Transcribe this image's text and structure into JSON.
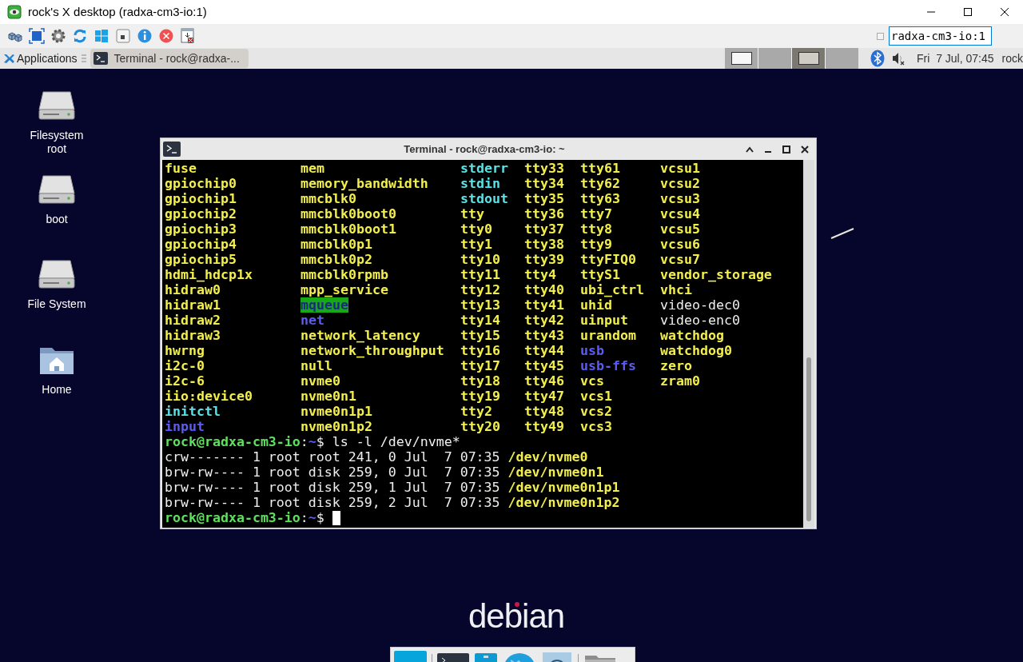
{
  "viewer_window": {
    "title": "rock's X desktop (radxa-cm3-io:1)",
    "address": "radxa-cm3-io:1"
  },
  "panel": {
    "menu": "Applications",
    "tasks": [
      {
        "label": "Terminal - rock@radxa-...",
        "selected": true
      }
    ],
    "workspaces": [
      {
        "selected": false,
        "has_window": true
      },
      {
        "selected": false,
        "has_window": false
      },
      {
        "selected": true,
        "has_window": true
      },
      {
        "selected": false,
        "has_window": false
      }
    ],
    "clock": "Fri  7 Jul, 07:45",
    "user": "rock"
  },
  "desktop_icons": [
    {
      "label": "Filesystem root",
      "kind": "drive"
    },
    {
      "label": "boot",
      "kind": "drive"
    },
    {
      "label": "File System",
      "kind": "drive"
    },
    {
      "label": "Home",
      "kind": "home"
    }
  ],
  "terminal": {
    "title": "Terminal - rock@radxa-cm3-io: ~",
    "listing": [
      [
        {
          "name": "fuse",
          "kind": "device"
        },
        {
          "name": "mem",
          "kind": "device"
        },
        {
          "name": "stderr",
          "kind": "link"
        },
        {
          "name": "tty33",
          "kind": "device"
        },
        {
          "name": "tty61",
          "kind": "device"
        },
        {
          "name": "vcsu1",
          "kind": "device"
        }
      ],
      [
        {
          "name": "gpiochip0",
          "kind": "device"
        },
        {
          "name": "memory_bandwidth",
          "kind": "device"
        },
        {
          "name": "stdin",
          "kind": "link"
        },
        {
          "name": "tty34",
          "kind": "device"
        },
        {
          "name": "tty62",
          "kind": "device"
        },
        {
          "name": "vcsu2",
          "kind": "device"
        }
      ],
      [
        {
          "name": "gpiochip1",
          "kind": "device"
        },
        {
          "name": "mmcblk0",
          "kind": "device"
        },
        {
          "name": "stdout",
          "kind": "link"
        },
        {
          "name": "tty35",
          "kind": "device"
        },
        {
          "name": "tty63",
          "kind": "device"
        },
        {
          "name": "vcsu3",
          "kind": "device"
        }
      ],
      [
        {
          "name": "gpiochip2",
          "kind": "device"
        },
        {
          "name": "mmcblk0boot0",
          "kind": "device"
        },
        {
          "name": "tty",
          "kind": "device"
        },
        {
          "name": "tty36",
          "kind": "device"
        },
        {
          "name": "tty7",
          "kind": "device"
        },
        {
          "name": "vcsu4",
          "kind": "device"
        }
      ],
      [
        {
          "name": "gpiochip3",
          "kind": "device"
        },
        {
          "name": "mmcblk0boot1",
          "kind": "device"
        },
        {
          "name": "tty0",
          "kind": "device"
        },
        {
          "name": "tty37",
          "kind": "device"
        },
        {
          "name": "tty8",
          "kind": "device"
        },
        {
          "name": "vcsu5",
          "kind": "device"
        }
      ],
      [
        {
          "name": "gpiochip4",
          "kind": "device"
        },
        {
          "name": "mmcblk0p1",
          "kind": "device"
        },
        {
          "name": "tty1",
          "kind": "device"
        },
        {
          "name": "tty38",
          "kind": "device"
        },
        {
          "name": "tty9",
          "kind": "device"
        },
        {
          "name": "vcsu6",
          "kind": "device"
        }
      ],
      [
        {
          "name": "gpiochip5",
          "kind": "device"
        },
        {
          "name": "mmcblk0p2",
          "kind": "device"
        },
        {
          "name": "tty10",
          "kind": "device"
        },
        {
          "name": "tty39",
          "kind": "device"
        },
        {
          "name": "ttyFIQ0",
          "kind": "device"
        },
        {
          "name": "vcsu7",
          "kind": "device"
        }
      ],
      [
        {
          "name": "hdmi_hdcp1x",
          "kind": "device"
        },
        {
          "name": "mmcblk0rpmb",
          "kind": "device"
        },
        {
          "name": "tty11",
          "kind": "device"
        },
        {
          "name": "tty4",
          "kind": "device"
        },
        {
          "name": "ttyS1",
          "kind": "device"
        },
        {
          "name": "vendor_storage",
          "kind": "device"
        }
      ],
      [
        {
          "name": "hidraw0",
          "kind": "device"
        },
        {
          "name": "mpp_service",
          "kind": "device"
        },
        {
          "name": "tty12",
          "kind": "device"
        },
        {
          "name": "tty40",
          "kind": "device"
        },
        {
          "name": "ubi_ctrl",
          "kind": "device"
        },
        {
          "name": "vhci",
          "kind": "device"
        }
      ],
      [
        {
          "name": "hidraw1",
          "kind": "device"
        },
        {
          "name": "mqueue",
          "kind": "sticky_dir"
        },
        {
          "name": "tty13",
          "kind": "device"
        },
        {
          "name": "tty41",
          "kind": "device"
        },
        {
          "name": "uhid",
          "kind": "device"
        },
        {
          "name": "video-dec0",
          "kind": "plain"
        }
      ],
      [
        {
          "name": "hidraw2",
          "kind": "device"
        },
        {
          "name": "net",
          "kind": "dir"
        },
        {
          "name": "tty14",
          "kind": "device"
        },
        {
          "name": "tty42",
          "kind": "device"
        },
        {
          "name": "uinput",
          "kind": "device"
        },
        {
          "name": "video-enc0",
          "kind": "plain"
        }
      ],
      [
        {
          "name": "hidraw3",
          "kind": "device"
        },
        {
          "name": "network_latency",
          "kind": "device"
        },
        {
          "name": "tty15",
          "kind": "device"
        },
        {
          "name": "tty43",
          "kind": "device"
        },
        {
          "name": "urandom",
          "kind": "device"
        },
        {
          "name": "watchdog",
          "kind": "device"
        }
      ],
      [
        {
          "name": "hwrng",
          "kind": "device"
        },
        {
          "name": "network_throughput",
          "kind": "device"
        },
        {
          "name": "tty16",
          "kind": "device"
        },
        {
          "name": "tty44",
          "kind": "device"
        },
        {
          "name": "usb",
          "kind": "dir"
        },
        {
          "name": "watchdog0",
          "kind": "device"
        }
      ],
      [
        {
          "name": "i2c-0",
          "kind": "device"
        },
        {
          "name": "null",
          "kind": "device"
        },
        {
          "name": "tty17",
          "kind": "device"
        },
        {
          "name": "tty45",
          "kind": "device"
        },
        {
          "name": "usb-ffs",
          "kind": "dir"
        },
        {
          "name": "zero",
          "kind": "device"
        }
      ],
      [
        {
          "name": "i2c-6",
          "kind": "device"
        },
        {
          "name": "nvme0",
          "kind": "device"
        },
        {
          "name": "tty18",
          "kind": "device"
        },
        {
          "name": "tty46",
          "kind": "device"
        },
        {
          "name": "vcs",
          "kind": "device"
        },
        {
          "name": "zram0",
          "kind": "device"
        }
      ],
      [
        {
          "name": "iio:device0",
          "kind": "device"
        },
        {
          "name": "nvme0n1",
          "kind": "device"
        },
        {
          "name": "tty19",
          "kind": "device"
        },
        {
          "name": "tty47",
          "kind": "device"
        },
        {
          "name": "vcs1",
          "kind": "device"
        }
      ],
      [
        {
          "name": "initctl",
          "kind": "link"
        },
        {
          "name": "nvme0n1p1",
          "kind": "device"
        },
        {
          "name": "tty2",
          "kind": "device"
        },
        {
          "name": "tty48",
          "kind": "device"
        },
        {
          "name": "vcs2",
          "kind": "device"
        }
      ],
      [
        {
          "name": "input",
          "kind": "dir"
        },
        {
          "name": "nvme0n1p2",
          "kind": "device"
        },
        {
          "name": "tty20",
          "kind": "device"
        },
        {
          "name": "tty49",
          "kind": "device"
        },
        {
          "name": "vcs3",
          "kind": "device"
        }
      ]
    ],
    "lines": [
      {
        "segments": [
          {
            "text": "rock@radxa-cm3-io",
            "kind": "user"
          },
          {
            "text": ":",
            "kind": "plain"
          },
          {
            "text": "~",
            "kind": "path"
          },
          {
            "text": "$ ls -l /dev/nvme*",
            "kind": "plain"
          }
        ],
        "cursor": false
      },
      {
        "segments": [
          {
            "text": "crw------- 1 root root 241, 0 Jul  7 07:35 ",
            "kind": "plain"
          },
          {
            "text": "/dev/nvme0",
            "kind": "device"
          }
        ],
        "cursor": false
      },
      {
        "segments": [
          {
            "text": "brw-rw---- 1 root disk 259, 0 Jul  7 07:35 ",
            "kind": "plain"
          },
          {
            "text": "/dev/nvme0n1",
            "kind": "device"
          }
        ],
        "cursor": false
      },
      {
        "segments": [
          {
            "text": "brw-rw---- 1 root disk 259, 1 Jul  7 07:35 ",
            "kind": "plain"
          },
          {
            "text": "/dev/nvme0n1p1",
            "kind": "device"
          }
        ],
        "cursor": false
      },
      {
        "segments": [
          {
            "text": "brw-rw---- 1 root disk 259, 2 Jul  7 07:35 ",
            "kind": "plain"
          },
          {
            "text": "/dev/nvme0n1p2",
            "kind": "device"
          }
        ],
        "cursor": false
      },
      {
        "segments": [
          {
            "text": "rock@radxa-cm3-io",
            "kind": "user"
          },
          {
            "text": ":",
            "kind": "plain"
          },
          {
            "text": "~",
            "kind": "path"
          },
          {
            "text": "$ ",
            "kind": "plain"
          }
        ],
        "cursor": true
      }
    ]
  },
  "logo": {
    "text": "debian"
  }
}
